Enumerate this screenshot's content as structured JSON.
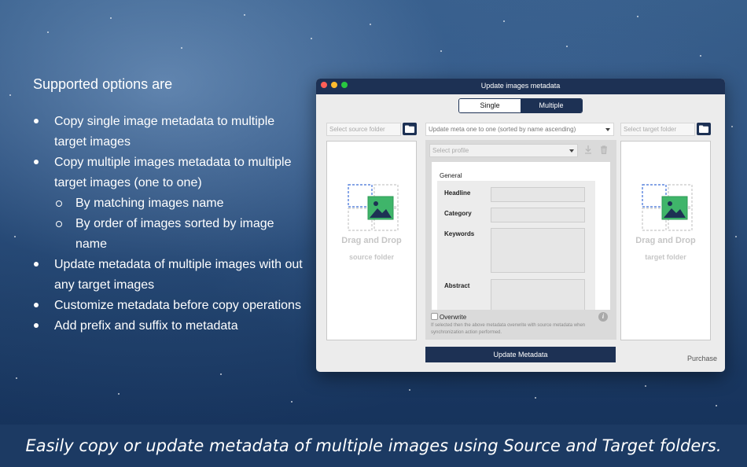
{
  "features": {
    "heading": "Supported options are",
    "items": [
      {
        "level": 1,
        "text": "Copy single image metadata to multiple target images"
      },
      {
        "level": 1,
        "text": "Copy multiple images metadata to multiple target images (one to one)"
      },
      {
        "level": 2,
        "text": "By matching images name"
      },
      {
        "level": 2,
        "text": "By order of images sorted by image name"
      },
      {
        "level": 1,
        "text": "Update metadata of multiple images with out any target images"
      },
      {
        "level": 1,
        "text": "Customize metadata before copy operations"
      },
      {
        "level": 1,
        "text": "Add prefix and suffix to metadata"
      }
    ]
  },
  "window": {
    "title": "Update images metadata",
    "tabs": {
      "single": "Single",
      "multiple": "Multiple",
      "active": "Multiple"
    },
    "source": {
      "placeholder": "Select source folder",
      "drop_title": "Drag and Drop",
      "drop_sub": "source folder"
    },
    "target": {
      "placeholder": "Select target folder",
      "drop_title": "Drag and Drop",
      "drop_sub": "target folder"
    },
    "mode_select": "Update meta one to one (sorted by name ascending)",
    "profile_placeholder": "Select profile",
    "form": {
      "section": "General",
      "fields": [
        "Headline",
        "Category",
        "Keywords",
        "Abstract"
      ]
    },
    "overwrite_label": "Overwrite",
    "overwrite_hint": "If selected then the above metadata overwrite with source metadata when synchronization action performed.",
    "update_button": "Update Metadata",
    "purchase": "Purchase"
  },
  "banner": "Easily copy or update metadata of multiple images using Source and Target folders.",
  "colors": {
    "navy": "#1d3154",
    "banner": "#1c3a63"
  }
}
